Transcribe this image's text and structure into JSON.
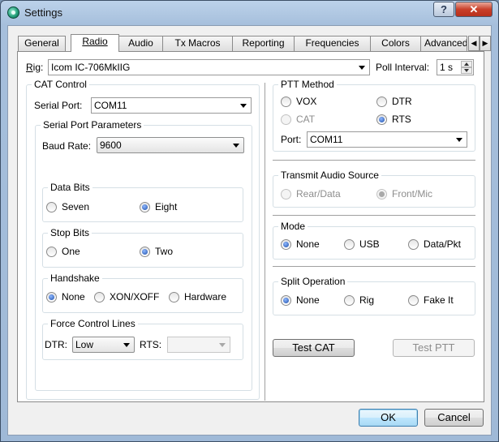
{
  "window": {
    "title": "Settings",
    "help_label": "?",
    "close_label": "✕"
  },
  "tabs": [
    {
      "label": "General"
    },
    {
      "label": "Radio"
    },
    {
      "label": "Audio"
    },
    {
      "label": "Tx Macros"
    },
    {
      "label": "Reporting"
    },
    {
      "label": "Frequencies"
    },
    {
      "label": "Colors"
    },
    {
      "label": "Advanced"
    }
  ],
  "active_tab": "Radio",
  "rig": {
    "label": "Rig:",
    "value": "Icom IC-706MkIIG"
  },
  "poll_interval": {
    "label": "Poll Interval:",
    "value": "1 s"
  },
  "cat_control": {
    "title": "CAT Control",
    "serial_port_label": "Serial Port:",
    "serial_port_value": "COM11",
    "params": {
      "title": "Serial Port Parameters",
      "baud_label": "Baud Rate:",
      "baud_value": "9600",
      "data_bits": {
        "title": "Data Bits",
        "options": [
          "Seven",
          "Eight"
        ],
        "selected": "Eight"
      },
      "stop_bits": {
        "title": "Stop Bits",
        "options": [
          "One",
          "Two"
        ],
        "selected": "Two"
      },
      "handshake": {
        "title": "Handshake",
        "options": [
          "None",
          "XON/XOFF",
          "Hardware"
        ],
        "selected": "None"
      },
      "force_lines": {
        "title": "Force Control Lines",
        "dtr_label": "DTR:",
        "dtr_value": "Low",
        "rts_label": "RTS:",
        "rts_value": ""
      }
    }
  },
  "ptt_method": {
    "title": "PTT Method",
    "options": [
      "VOX",
      "DTR",
      "CAT",
      "RTS"
    ],
    "selected": "RTS",
    "port_label": "Port:",
    "port_value": "COM11"
  },
  "transmit_audio": {
    "title": "Transmit Audio Source",
    "options": [
      "Rear/Data",
      "Front/Mic"
    ],
    "selected": "Front/Mic"
  },
  "mode": {
    "title": "Mode",
    "options": [
      "None",
      "USB",
      "Data/Pkt"
    ],
    "selected": "None"
  },
  "split": {
    "title": "Split Operation",
    "options": [
      "None",
      "Rig",
      "Fake It"
    ],
    "selected": "None"
  },
  "buttons": {
    "test_cat": "Test CAT",
    "test_ptt": "Test PTT",
    "ok": "OK",
    "cancel": "Cancel"
  }
}
